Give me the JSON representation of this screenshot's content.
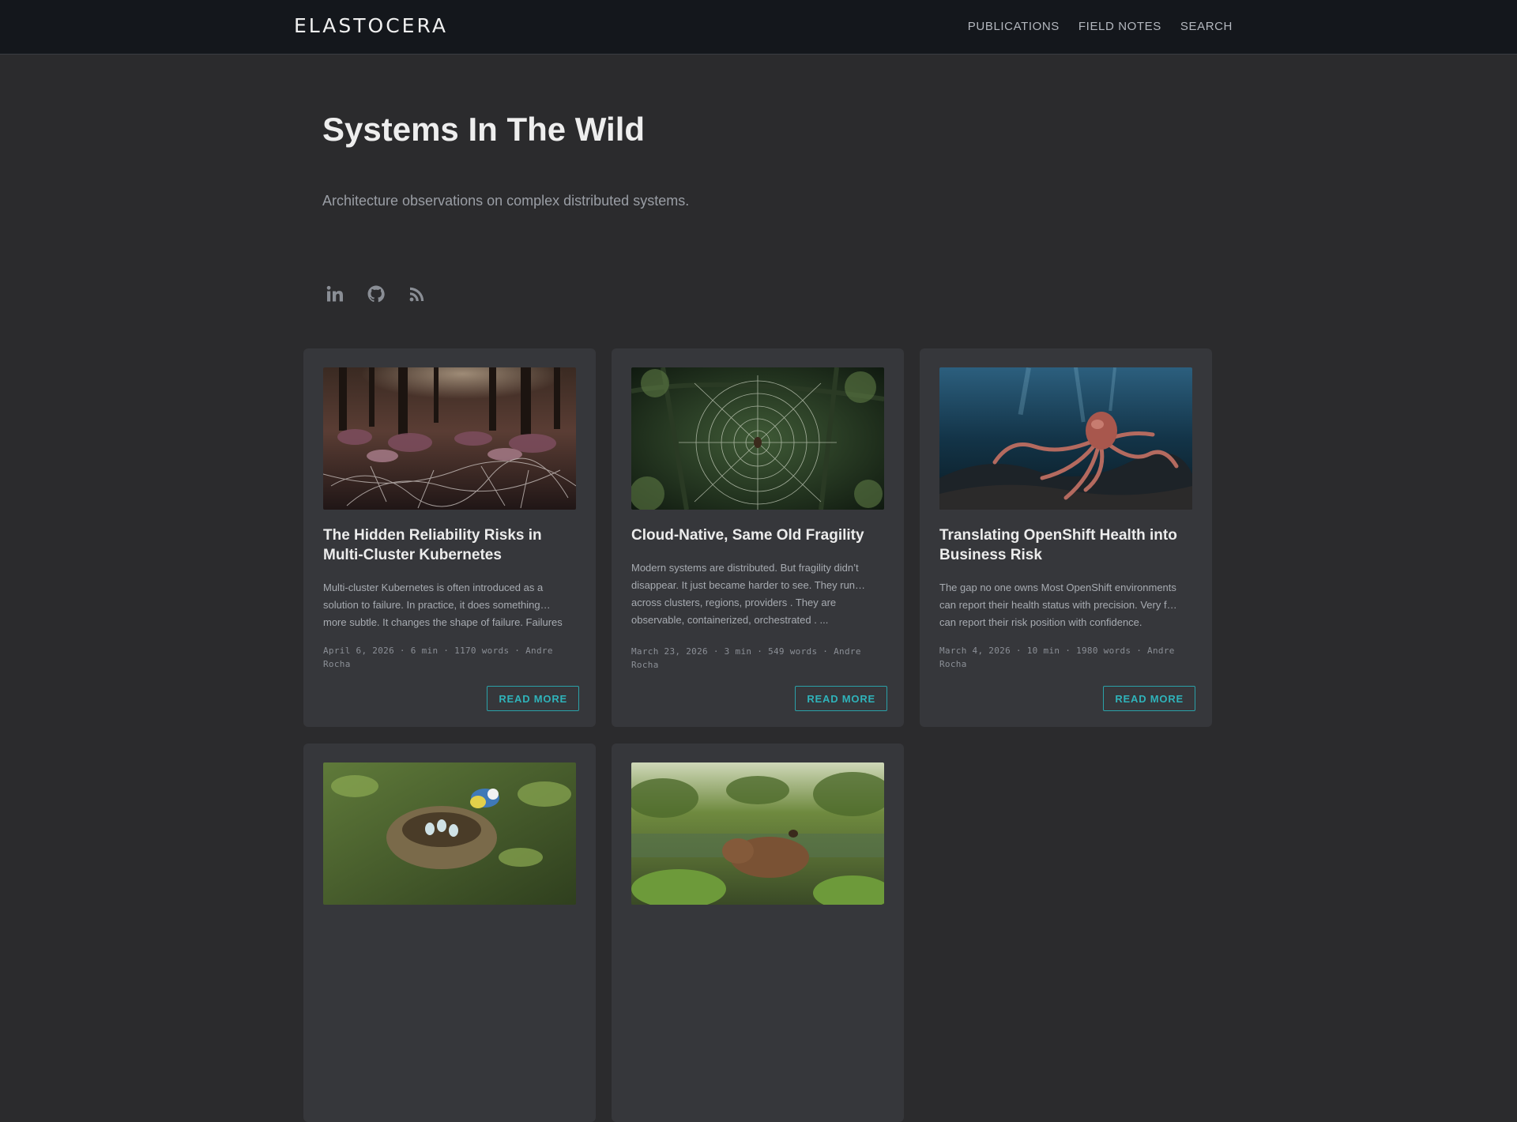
{
  "header": {
    "brand": "ELASTOCERA",
    "nav": [
      {
        "label": "PUBLICATIONS"
      },
      {
        "label": "FIELD NOTES"
      },
      {
        "label": "SEARCH"
      }
    ]
  },
  "hero": {
    "title": "Systems In The Wild",
    "subtitle": "Architecture observations on complex distributed systems."
  },
  "socials": [
    {
      "icon": "linkedin-icon"
    },
    {
      "icon": "github-icon"
    },
    {
      "icon": "rss-icon"
    }
  ],
  "posts": [
    {
      "title": "The Hidden Reliability Risks in Multi-Cluster Kubernetes",
      "excerpt": "Multi-cluster Kubernetes is often introduced as a solution to failure. In practice, it does something… more subtle. It changes the shape of failure. Failures",
      "meta": "April 6, 2026 · 6 min · 1170 words · Andre Rocha",
      "cta": "READ MORE",
      "image": "forest-mycelium-image"
    },
    {
      "title": "Cloud-Native, Same Old Fragility",
      "excerpt": "Modern systems are distributed. But fragility didn’t disappear. It just became harder to see. They run… across clusters, regions, providers . They are observable, containerized, orchestrated . ...",
      "meta": "March 23, 2026 · 3 min · 549 words · Andre Rocha",
      "cta": "READ MORE",
      "image": "spider-web-image"
    },
    {
      "title": "Translating OpenShift Health into Business Risk",
      "excerpt": "The gap no one owns Most OpenShift environments can report their health status with precision. Very f… can report their risk position with confidence.",
      "meta": "March 4, 2026 · 10 min · 1980 words · Andre Rocha",
      "cta": "READ MORE",
      "image": "octopus-reef-image"
    },
    {
      "title": "",
      "excerpt": "",
      "meta": "",
      "cta": "",
      "image": "bird-nest-image"
    },
    {
      "title": "",
      "excerpt": "",
      "meta": "",
      "cta": "",
      "image": "capybara-river-image"
    }
  ]
}
